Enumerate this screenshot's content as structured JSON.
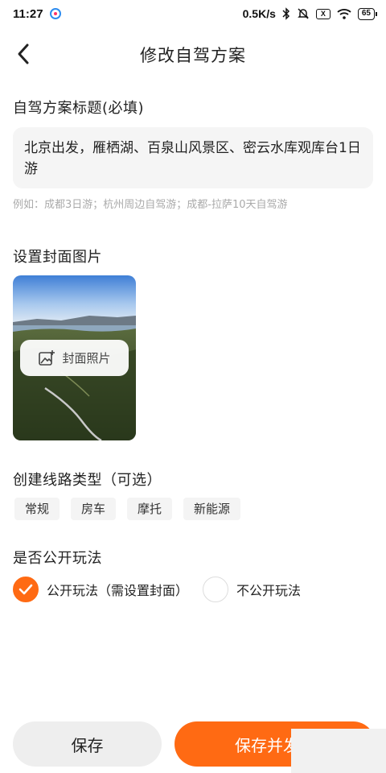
{
  "status_bar": {
    "time": "11:27",
    "network_speed": "0.5K/s",
    "battery": "65",
    "sim_label": "X",
    "icons": [
      "app-icon",
      "bluetooth-icon",
      "mute-icon",
      "sim-icon",
      "wifi-icon",
      "battery-icon"
    ]
  },
  "nav": {
    "title": "修改自驾方案",
    "back_icon": "chevron-left-icon"
  },
  "title_section": {
    "label": "自驾方案标题(必填)",
    "value": "北京出发，雁栖湖、百泉山风景区、密云水库观库台1日游",
    "hint": "例如：成都3日游；杭州周边自驾游；成都-拉萨10天自驾游"
  },
  "cover_section": {
    "label": "设置封面图片",
    "button_label": "封面照片",
    "button_icon": "image-add-icon"
  },
  "route_type_section": {
    "label": "创建线路类型（可选）",
    "options": [
      "常规",
      "房车",
      "摩托",
      "新能源"
    ]
  },
  "public_section": {
    "label": "是否公开玩法",
    "options": [
      {
        "label": "公开玩法（需设置封面）",
        "checked": true
      },
      {
        "label": "不公开玩法",
        "checked": false
      }
    ]
  },
  "footer": {
    "save_label": "保存",
    "publish_label": "保存并发布"
  },
  "colors": {
    "accent": "#ff6a13",
    "input_bg": "#f5f5f5",
    "hint_text": "#aaaaaa"
  }
}
